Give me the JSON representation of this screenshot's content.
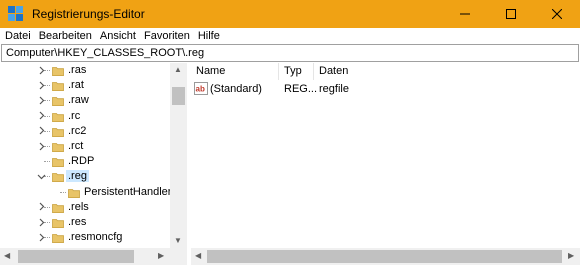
{
  "window": {
    "title": "Registrierungs-Editor",
    "titlebar_color": "#f0a214"
  },
  "menu": [
    "Datei",
    "Bearbeiten",
    "Ansicht",
    "Favoriten",
    "Hilfe"
  ],
  "address": "Computer\\HKEY_CLASSES_ROOT\\.reg",
  "tree": {
    "items": [
      {
        "label": ".ras",
        "expander": "collapsed"
      },
      {
        "label": ".rat",
        "expander": "collapsed"
      },
      {
        "label": ".raw",
        "expander": "collapsed"
      },
      {
        "label": ".rc",
        "expander": "collapsed"
      },
      {
        "label": ".rc2",
        "expander": "collapsed"
      },
      {
        "label": ".rct",
        "expander": "collapsed"
      },
      {
        "label": ".RDP",
        "expander": "none"
      },
      {
        "label": ".reg",
        "expander": "expanded",
        "selected": true
      },
      {
        "label": "PersistentHandler",
        "expander": "none",
        "child": true
      },
      {
        "label": ".rels",
        "expander": "collapsed"
      },
      {
        "label": ".res",
        "expander": "collapsed"
      },
      {
        "label": ".resmoncfg",
        "expander": "collapsed"
      }
    ]
  },
  "list": {
    "columns": [
      "Name",
      "Typ",
      "Daten"
    ],
    "rows": [
      {
        "name": "(Standard)",
        "type": "REG...",
        "data": "regfile",
        "icon": "string-value-icon"
      }
    ]
  },
  "colors": {
    "selection": "#cce8ff",
    "folder": "#e8c468",
    "scrollbar_thumb": "#c1c1c1"
  }
}
